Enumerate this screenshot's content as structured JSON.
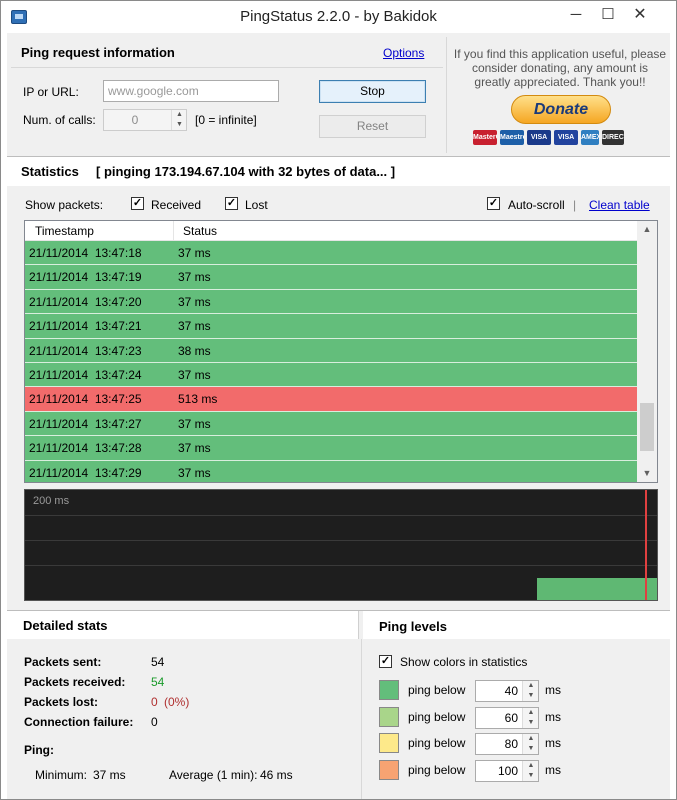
{
  "window": {
    "title": "PingStatus 2.2.0 - by Bakidok",
    "minimize_glyph": "─",
    "maximize_glyph": "☐",
    "close_glyph": "✕"
  },
  "ping_request": {
    "title": "Ping request information",
    "options_link": "Options",
    "ip_label": "IP or URL:",
    "ip_placeholder": "www.google.com",
    "calls_label": "Num. of calls:",
    "calls_value": "0",
    "calls_hint": "[0 = infinite]",
    "stop_button": "Stop",
    "reset_button": "Reset"
  },
  "donate": {
    "message_line1": "If you find this application useful, please",
    "message_line2": "consider donating, any amount is",
    "message_line3": "greatly appreciated. Thank you!!",
    "button": "Donate",
    "cards": [
      {
        "name": "MasterCard",
        "color": "#c8202f"
      },
      {
        "name": "Maestro",
        "color": "#1d5fa8"
      },
      {
        "name": "VISA",
        "color": "#1a3a8a"
      },
      {
        "name": "VISA",
        "color": "#22439e"
      },
      {
        "name": "AMEX",
        "color": "#2f7fc1"
      },
      {
        "name": "DIRECT Deb",
        "color": "#333333"
      }
    ]
  },
  "statistics": {
    "title": "Statistics",
    "status_text": "[ pinging 173.194.67.104 with 32 bytes of data... ]",
    "show_packets_label": "Show packets:",
    "received_label": "Received",
    "received_checked": true,
    "lost_label": "Lost",
    "lost_checked": true,
    "autoscroll_label": "Auto-scroll",
    "autoscroll_checked": true,
    "separator": "|",
    "clean_table_link": "Clean table",
    "columns": [
      "Timestamp",
      "Status"
    ],
    "rows": [
      {
        "timestamp": "21/11/2014  13:47:18",
        "status": "37 ms",
        "state": "ok"
      },
      {
        "timestamp": "21/11/2014  13:47:19",
        "status": "37 ms",
        "state": "ok"
      },
      {
        "timestamp": "21/11/2014  13:47:20",
        "status": "37 ms",
        "state": "ok"
      },
      {
        "timestamp": "21/11/2014  13:47:21",
        "status": "37 ms",
        "state": "ok"
      },
      {
        "timestamp": "21/11/2014  13:47:23",
        "status": "38 ms",
        "state": "ok"
      },
      {
        "timestamp": "21/11/2014  13:47:24",
        "status": "37 ms",
        "state": "ok"
      },
      {
        "timestamp": "21/11/2014  13:47:25",
        "status": "513 ms",
        "state": "bad"
      },
      {
        "timestamp": "21/11/2014  13:47:27",
        "status": "37 ms",
        "state": "ok"
      },
      {
        "timestamp": "21/11/2014  13:47:28",
        "status": "37 ms",
        "state": "ok"
      },
      {
        "timestamp": "21/11/2014  13:47:29",
        "status": "37 ms",
        "state": "ok"
      }
    ],
    "graph_label": "200 ms",
    "colors": {
      "ok": "#63be7b",
      "bad": "#f26b6b"
    }
  },
  "detailed_stats": {
    "title": "Detailed stats",
    "packets_sent_label": "Packets sent:",
    "packets_sent_value": "54",
    "packets_received_label": "Packets received:",
    "packets_received_value": "54",
    "packets_lost_label": "Packets lost:",
    "packets_lost_value": "0",
    "packets_lost_pct": "(0%)",
    "connection_failure_label": "Connection failure:",
    "connection_failure_value": "0",
    "ping_label": "Ping:",
    "minimum_label": "Minimum:",
    "minimum_value": "37 ms",
    "average_1min_label": "Average (1 min):",
    "average_1min_value": "46 ms"
  },
  "ping_levels": {
    "title": "Ping levels",
    "show_colors_label": "Show colors in statistics",
    "show_colors_checked": true,
    "levels": [
      {
        "label": "ping below",
        "value": "40",
        "unit": "ms",
        "color": "#63be7b"
      },
      {
        "label": "ping below",
        "value": "60",
        "unit": "ms",
        "color": "#a9d58a"
      },
      {
        "label": "ping below",
        "value": "80",
        "unit": "ms",
        "color": "#fde98a"
      },
      {
        "label": "ping below",
        "value": "100",
        "unit": "ms",
        "color": "#f7a372"
      }
    ]
  }
}
